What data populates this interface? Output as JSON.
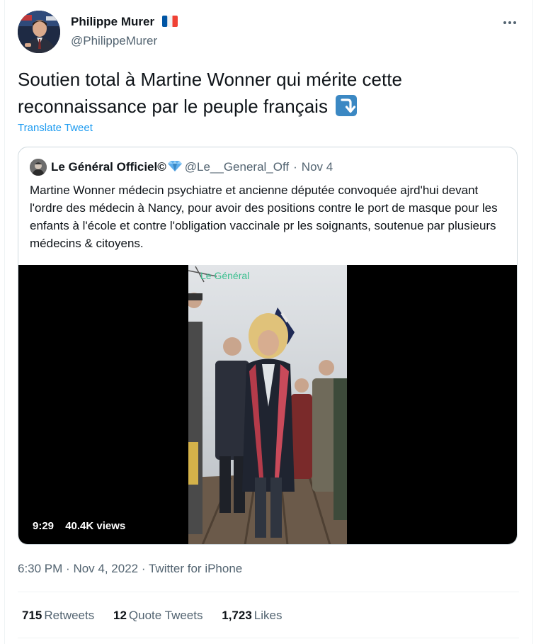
{
  "tweet": {
    "author_name": "Philippe Murer",
    "author_handle": "@PhilippeMurer",
    "author_flag": "france-flag-icon",
    "more_icon": "more-horizontal-icon",
    "text": "Soutien total à Martine Wonner qui mérite cette reconnaissance par le peuple français",
    "text_emoji": "arrow-down-right-icon",
    "translate_label": "Translate Tweet",
    "time": "6:30 PM",
    "date": "Nov 4, 2022",
    "source": "Twitter for iPhone",
    "timeline_sep": "·"
  },
  "quote": {
    "author_name": "Le Général Officiel©",
    "badge_icon": "gem-icon",
    "author_handle": "@Le__General_Off",
    "dot": "·",
    "date": "Nov 4",
    "text": "Martine Wonner médecin psychiatre et ancienne députée convoquée ajrd'hui devant l'ordre des médecin à Nancy, pour avoir des positions contre le port de masque pour les enfants à l'école et contre l'obligation vaccinale pr les soignants, soutenue par plusieurs médecins & citoyens.",
    "video": {
      "watermark": "Le Général",
      "duration": "9:29",
      "views": "40.4K views"
    }
  },
  "stats": [
    {
      "count": "715",
      "label": "Retweets"
    },
    {
      "count": "12",
      "label": "Quote Tweets"
    },
    {
      "count": "1,723",
      "label": "Likes"
    }
  ],
  "colors": {
    "accent": "#1d9bf0",
    "text_primary": "#0f1419",
    "text_secondary": "#536471",
    "border": "#cfd9de",
    "emoji_blue": "#3b88c3"
  }
}
